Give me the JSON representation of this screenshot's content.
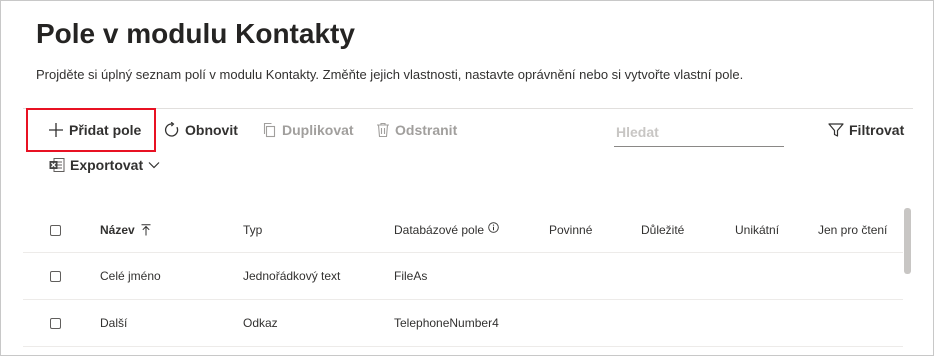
{
  "page": {
    "title": "Pole v modulu Kontakty",
    "description": "Projděte si úplný seznam polí v modulu Kontakty. Změňte jejich vlastnosti, nastavte oprávnění nebo si vytvořte vlastní pole."
  },
  "toolbar": {
    "add_label": "Přidat pole",
    "refresh_label": "Obnovit",
    "duplicate_label": "Duplikovat",
    "delete_label": "Odstranit",
    "search_placeholder": "Hledat",
    "filter_label": "Filtrovat",
    "export_label": "Exportovat"
  },
  "table": {
    "columns": {
      "name": "Název",
      "type": "Typ",
      "db_field": "Databázové pole",
      "required": "Povinné",
      "important": "Důležité",
      "unique": "Unikátní",
      "readonly": "Jen pro čtení"
    },
    "rows": [
      {
        "name": "Celé jméno",
        "type": "Jednořádkový text",
        "db_field": "FileAs"
      },
      {
        "name": "Další",
        "type": "Odkaz",
        "db_field": "TelephoneNumber4"
      }
    ]
  },
  "icons": {
    "add": "plus-icon",
    "refresh": "refresh-icon",
    "duplicate": "copy-icon",
    "delete": "trash-icon",
    "filter": "filter-icon",
    "export": "excel-icon",
    "sort": "sort-ascending-icon",
    "info": "info-icon",
    "dropdown": "chevron-down-icon"
  },
  "colors": {
    "highlight": "#e81123",
    "excel": "#217346",
    "disabled": "#a19f9d"
  }
}
